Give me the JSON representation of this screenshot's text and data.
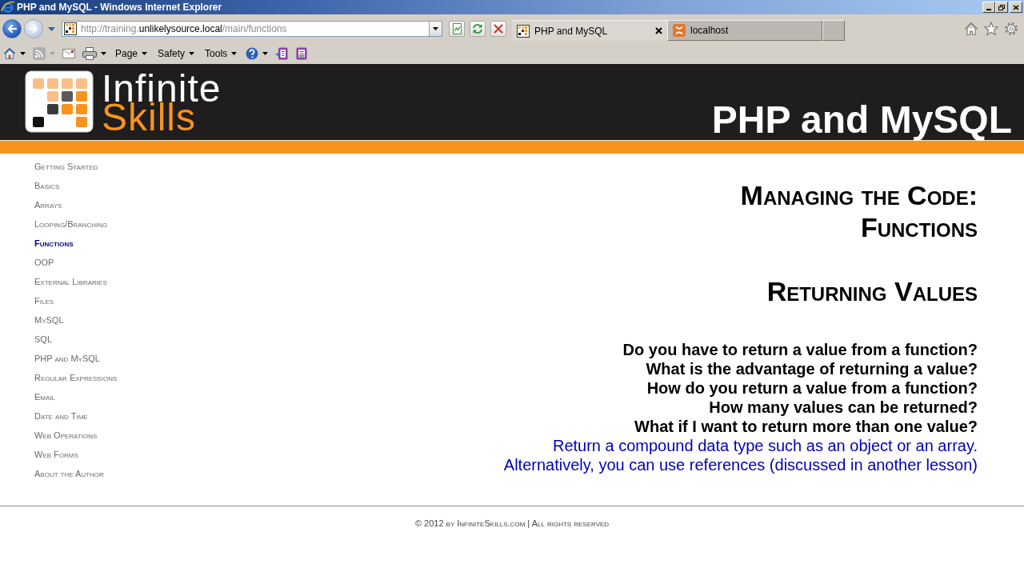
{
  "window": {
    "title": "PHP and MySQL - Windows Internet Explorer"
  },
  "address_bar": {
    "url_parts": [
      {
        "text": "http://training.",
        "emphasis": false
      },
      {
        "text": "unlikelysource.local",
        "emphasis": true
      },
      {
        "text": "/main/functions",
        "emphasis": false
      }
    ]
  },
  "tabs": [
    {
      "label": "PHP and MySQL",
      "kind": "grid",
      "selected": true
    },
    {
      "label": "localhost",
      "kind": "tile",
      "selected": false
    }
  ],
  "command_bar": {
    "items": [
      {
        "kind": "home",
        "dropdown": true,
        "disabled": false
      },
      {
        "kind": "feeds",
        "dropdown": true,
        "disabled": true
      },
      {
        "kind": "mail",
        "dropdown": false,
        "disabled": false
      },
      {
        "kind": "print",
        "dropdown": true,
        "disabled": false
      },
      {
        "kind": "menu",
        "label": "Page",
        "dropdown": true,
        "disabled": false
      },
      {
        "kind": "menu",
        "label": "Safety",
        "dropdown": true,
        "disabled": false
      },
      {
        "kind": "menu",
        "label": "Tools",
        "dropdown": true,
        "disabled": false
      },
      {
        "kind": "help",
        "dropdown": true,
        "disabled": false
      },
      {
        "kind": "note-send",
        "dropdown": false,
        "disabled": false
      },
      {
        "kind": "note-link",
        "dropdown": false,
        "disabled": false
      }
    ]
  },
  "site": {
    "logo": [
      "Infinite",
      "Skills"
    ],
    "banner_title": "PHP and MySQL"
  },
  "sidebar": {
    "items": [
      {
        "label": "Getting Started",
        "selected": false
      },
      {
        "label": "Basics",
        "selected": false
      },
      {
        "label": "Arrays",
        "selected": false
      },
      {
        "label": "Looping/Branching",
        "selected": false
      },
      {
        "label": "Functions",
        "selected": true
      },
      {
        "label": "OOP",
        "selected": false
      },
      {
        "label": "External Libraries",
        "selected": false
      },
      {
        "label": "Files",
        "selected": false
      },
      {
        "label": "MySQL",
        "selected": false
      },
      {
        "label": "SQL",
        "selected": false
      },
      {
        "label": "PHP and MySQL",
        "selected": false
      },
      {
        "label": "Regular Expressions",
        "selected": false
      },
      {
        "label": "Email",
        "selected": false
      },
      {
        "label": "Date and Time",
        "selected": false
      },
      {
        "label": "Web Operations",
        "selected": false
      },
      {
        "label": "Web Forms",
        "selected": false
      },
      {
        "label": "About the Author",
        "selected": false
      }
    ]
  },
  "content": {
    "title": "Managing the Code: Functions",
    "section_title": "Returning Values",
    "lines": [
      {
        "kind": "question",
        "text": "Do you have to return a value from a function?"
      },
      {
        "kind": "question",
        "text": "What is the advantage of returning a value?"
      },
      {
        "kind": "question",
        "text": "How do you return a value from a function?"
      },
      {
        "kind": "question",
        "text": "How many values can be returned?"
      },
      {
        "kind": "question",
        "text": "What if I want to return more than one value?"
      },
      {
        "kind": "answer",
        "text": "Return a compound data type such as an object or an array."
      },
      {
        "kind": "answer",
        "text": "Alternatively, you can use references (discussed in another lesson)"
      }
    ]
  },
  "footer": {
    "text": "© 2012 by InfiniteSkills.com | All rights reserved"
  }
}
